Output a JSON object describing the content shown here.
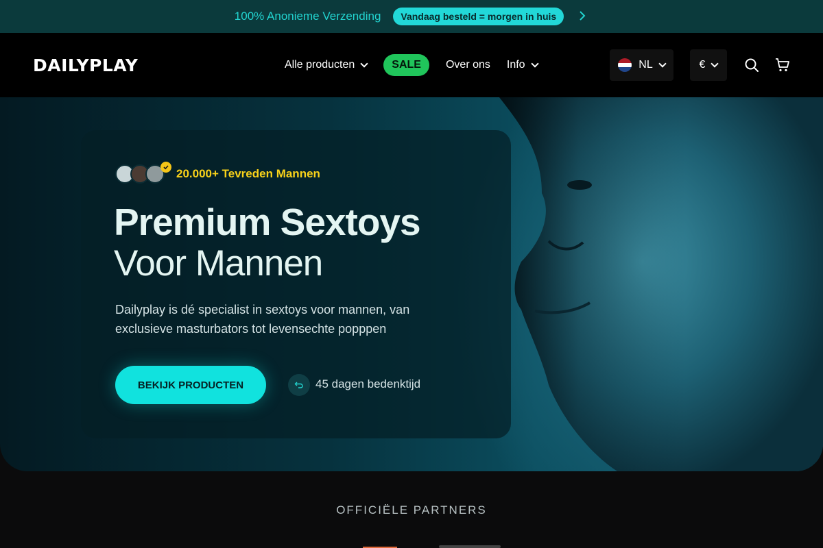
{
  "announcement": {
    "text": "100% Anonieme Verzending",
    "pill": "Vandaag besteld = morgen in huis"
  },
  "header": {
    "logo": "DAILYPLAY",
    "nav": [
      {
        "label": "Alle producten",
        "dropdown": true
      },
      {
        "label": "SALE",
        "dropdown": false
      },
      {
        "label": "Over ons",
        "dropdown": false
      },
      {
        "label": "Info",
        "dropdown": true
      }
    ],
    "language": "NL",
    "currency": "€"
  },
  "hero": {
    "social_proof": "20.000+ Tevreden Mannen",
    "title_line1": "Premium Sextoys",
    "title_line2": "Voor Mannen",
    "description": "Dailyplay is dé specialist in sextoys voor mannen, van exclusieve masturbators tot levensechte popppen",
    "cta_label": "BEKIJK PRODUCTEN",
    "return_policy": "45 dagen bedenktijd"
  },
  "partners": {
    "heading": "OFFICIËLE PARTNERS"
  },
  "colors": {
    "accent": "#11e2de",
    "sale": "#20c55b",
    "highlight": "#f9d21a",
    "announce_bg": "#0b3a3c"
  }
}
